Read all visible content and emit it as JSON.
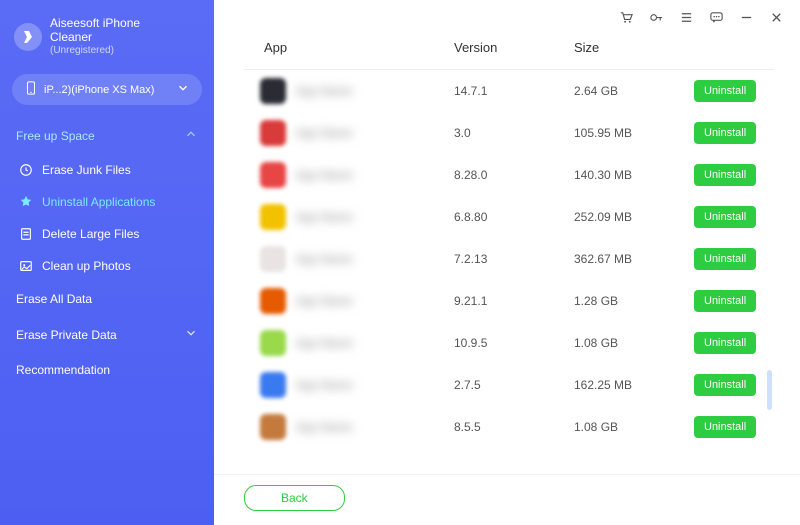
{
  "brand": {
    "title": "Aiseesoft iPhone\nCleaner",
    "subtitle": "(Unregistered)"
  },
  "device": {
    "label": "iP...2)(iPhone XS Max)"
  },
  "sidebar": {
    "free_up_space": {
      "label": "Free up Space",
      "expanded": true,
      "items": [
        {
          "icon": "clock-icon",
          "label": "Erase Junk Files"
        },
        {
          "icon": "star-icon",
          "label": "Uninstall Applications"
        },
        {
          "icon": "file-icon",
          "label": "Delete Large Files"
        },
        {
          "icon": "image-icon",
          "label": "Clean up Photos"
        }
      ]
    },
    "erase_all": {
      "label": "Erase All Data"
    },
    "erase_private": {
      "label": "Erase Private Data"
    },
    "recommendation": {
      "label": "Recommendation"
    }
  },
  "columns": {
    "app": "App",
    "version": "Version",
    "size": "Size"
  },
  "apps": [
    {
      "color": "#2a2b33",
      "version": "14.7.1",
      "size": "2.64 GB"
    },
    {
      "color": "#d93a3a",
      "version": "3.0",
      "size": "105.95 MB"
    },
    {
      "color": "#e84545",
      "version": "8.28.0",
      "size": "140.30 MB"
    },
    {
      "color": "#f2c200",
      "version": "6.8.80",
      "size": "252.09 MB"
    },
    {
      "color": "#e9e3e3",
      "version": "7.2.13",
      "size": "362.67 MB"
    },
    {
      "color": "#e65a00",
      "version": "9.21.1",
      "size": "1.28 GB"
    },
    {
      "color": "#99d94a",
      "version": "10.9.5",
      "size": "1.08 GB"
    },
    {
      "color": "#3a7af0",
      "version": "2.7.5",
      "size": "162.25 MB"
    },
    {
      "color": "#c47a3c",
      "version": "8.5.5",
      "size": "1.08 GB"
    }
  ],
  "buttons": {
    "uninstall": "Uninstall",
    "back": "Back"
  },
  "colors": {
    "sidebar": "#5a6cf5",
    "accent": "#7de8ff",
    "action": "#2ecc40"
  }
}
